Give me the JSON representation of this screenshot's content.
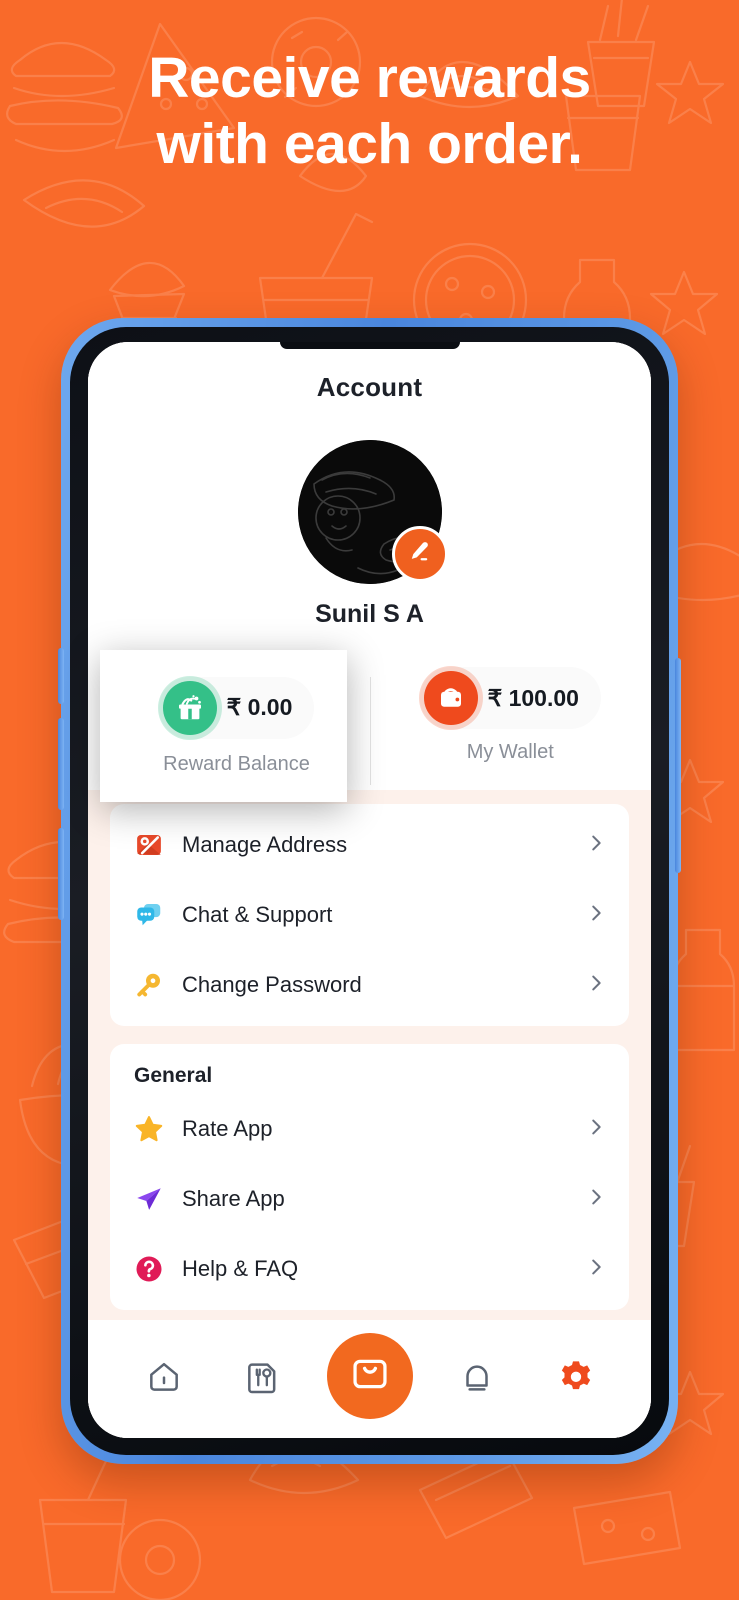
{
  "promo": {
    "headline_line1": "Receive rewards",
    "headline_line2": "with each order.",
    "bg_color": "#f96a2a",
    "text_color": "#ffffff"
  },
  "app": {
    "page_title": "Account",
    "profile": {
      "name": "Sunil S A",
      "avatar_name": "user-avatar",
      "edit_badge_label": "edit-profile"
    },
    "stats": [
      {
        "icon": "gift-icon",
        "icon_color": "#34c088",
        "value": "₹ 0.00",
        "label": "Reward Balance",
        "highlighted": true
      },
      {
        "icon": "wallet-icon",
        "icon_color": "#ef4a1d",
        "value": "₹ 100.00",
        "label": "My Wallet",
        "highlighted": false
      }
    ],
    "menu_cards": [
      {
        "section_title": null,
        "items": [
          {
            "icon": "map-location-icon",
            "icon_color": "#e8492a",
            "label": "Manage Address"
          },
          {
            "icon": "chat-bubbles-icon",
            "icon_color": "#2fb8e8",
            "label": "Chat & Support"
          },
          {
            "icon": "key-icon",
            "icon_color": "#f5b731",
            "label": "Change Password"
          }
        ]
      },
      {
        "section_title": "General",
        "items": [
          {
            "icon": "star-icon",
            "icon_color": "#f9b427",
            "label": "Rate App"
          },
          {
            "icon": "send-arrow-icon",
            "icon_color": "#7d3ce0",
            "label": "Share App"
          },
          {
            "icon": "question-circle-icon",
            "icon_color": "#e01b57",
            "label": "Help & FAQ"
          }
        ]
      }
    ],
    "bottom_nav": [
      {
        "icon": "home-icon",
        "name": "home",
        "active": false
      },
      {
        "icon": "restaurant-menu-icon",
        "name": "menu",
        "active": false
      },
      {
        "icon": "shopping-bag-icon",
        "name": "orders",
        "active": false,
        "fab": true
      },
      {
        "icon": "bell-icon",
        "name": "notifications",
        "active": false
      },
      {
        "icon": "gear-icon",
        "name": "settings",
        "active": true
      }
    ]
  },
  "theme": {
    "accent": "#f2691f",
    "accent_dark": "#e8492a",
    "screen_bg": "#fdf1eb",
    "card_bg": "#ffffff",
    "text_primary": "#1d2129",
    "text_muted": "#8a8f98",
    "chevron": "#6b7280",
    "phone_frame": "#4a86dd"
  }
}
